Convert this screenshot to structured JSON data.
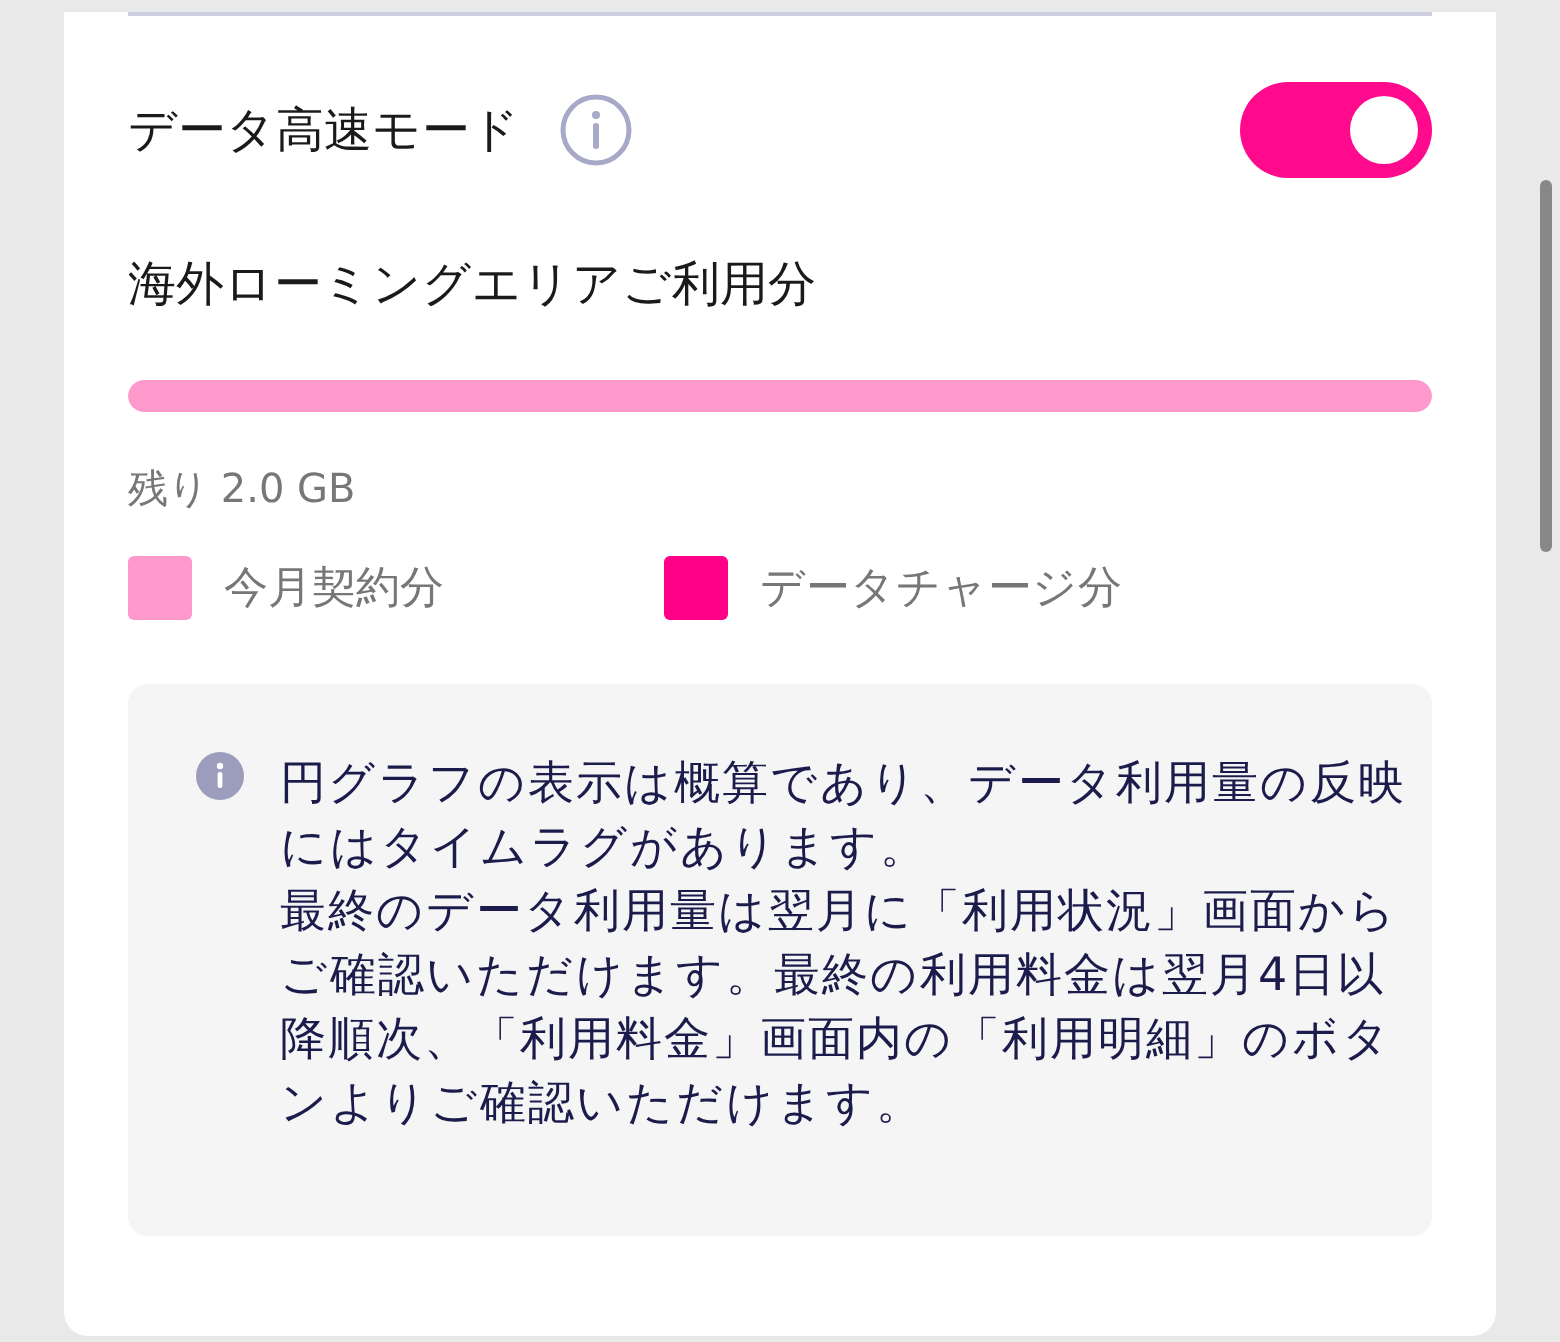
{
  "setting": {
    "label": "データ高速モード",
    "on": true
  },
  "usage": {
    "title": "海外ローミングエリアご利用分",
    "level": 1,
    "remaining": "残り 2.0 GB"
  },
  "legend": [
    {
      "label": "今月契約分",
      "color": "#ff99cc"
    },
    {
      "label": "データチャージ分",
      "color": "#ff0088"
    }
  ],
  "note": [
    "円グラフの表示は概算であり、データ利用量の反映にはタイムラグがあります。",
    "最終のデータ利用量は翌月に「利用状況」画面からご確認いただけます。最終の利用料金は翌月4日以降順次、「利用料金」画面内の「利用明細」のボタンよりご確認いただけます。"
  ]
}
